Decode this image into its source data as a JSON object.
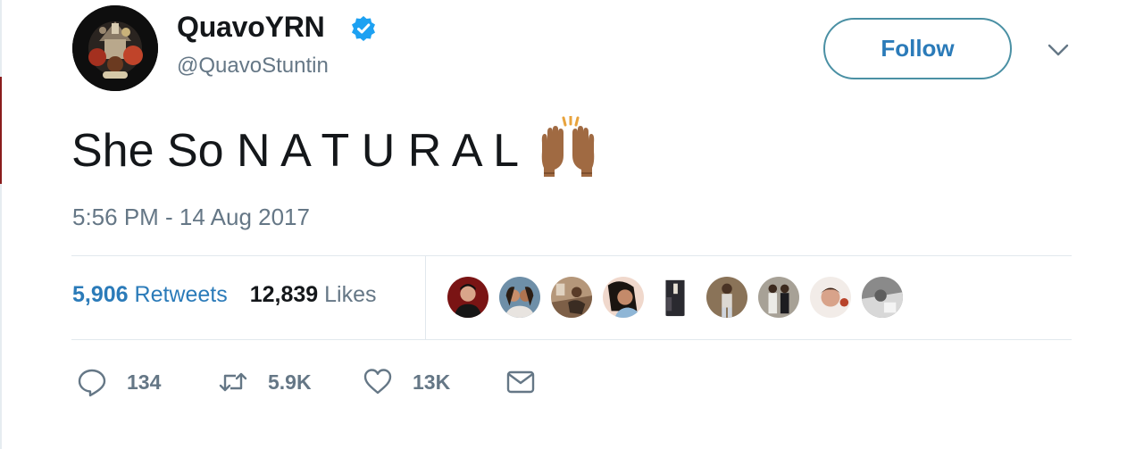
{
  "user": {
    "display_name": "QuavoYRN",
    "handle": "@QuavoStuntin",
    "verified": true,
    "avatar_icon": "album-art-avatar"
  },
  "header": {
    "follow_label": "Follow",
    "menu_icon": "chevron-down-icon"
  },
  "tweet": {
    "text": "She So N A T U R A L",
    "emoji": "raised-hands-emoji",
    "timestamp": "5:56 PM - 14 Aug 2017"
  },
  "stats": {
    "retweets_count": "5,906",
    "retweets_label": "Retweets",
    "likes_count": "12,839",
    "likes_label": "Likes"
  },
  "liker_avatars": [
    {
      "name": "liker-avatar-1"
    },
    {
      "name": "liker-avatar-2"
    },
    {
      "name": "liker-avatar-3"
    },
    {
      "name": "liker-avatar-4"
    },
    {
      "name": "liker-avatar-5"
    },
    {
      "name": "liker-avatar-6"
    },
    {
      "name": "liker-avatar-7"
    },
    {
      "name": "liker-avatar-8"
    },
    {
      "name": "liker-avatar-9"
    }
  ],
  "actions": {
    "reply_count": "134",
    "retweet_count": "5.9K",
    "like_count": "13K",
    "dm_icon": "envelope-icon"
  },
  "colors": {
    "link_blue": "#2b7bb9",
    "verified_blue": "#1da1f2",
    "muted_gray": "#657786",
    "text_dark": "#14171a",
    "divider": "#e1e8ed"
  }
}
